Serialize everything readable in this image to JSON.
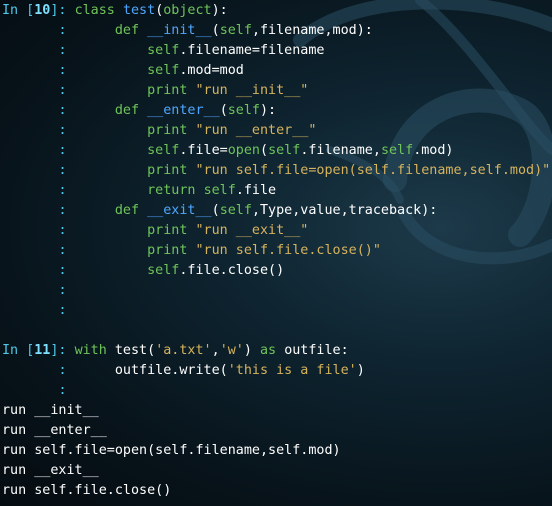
{
  "cells": [
    {
      "in_label": "In [",
      "number": "10",
      "in_close": "]:",
      "lines": [
        [
          {
            "t": "class ",
            "c": "kw"
          },
          {
            "t": "test",
            "c": "fn"
          },
          {
            "t": "(",
            "c": "var"
          },
          {
            "t": "object",
            "c": "bi"
          },
          {
            "t": "):",
            "c": "var"
          }
        ],
        [
          {
            "t": "    "
          },
          {
            "t": "def ",
            "c": "kw"
          },
          {
            "t": "__init__",
            "c": "fn"
          },
          {
            "t": "(",
            "c": "var"
          },
          {
            "t": "self",
            "c": "slf"
          },
          {
            "t": ",filename,mod):",
            "c": "var"
          }
        ],
        [
          {
            "t": "        "
          },
          {
            "t": "self",
            "c": "slf"
          },
          {
            "t": ".filename=filename",
            "c": "var"
          }
        ],
        [
          {
            "t": "        "
          },
          {
            "t": "self",
            "c": "slf"
          },
          {
            "t": ".mod=mod",
            "c": "var"
          }
        ],
        [
          {
            "t": "        "
          },
          {
            "t": "print ",
            "c": "kw"
          },
          {
            "t": "\"run __init__\"",
            "c": "str"
          }
        ],
        [
          {
            "t": "    "
          },
          {
            "t": "def ",
            "c": "kw"
          },
          {
            "t": "__enter__",
            "c": "fn"
          },
          {
            "t": "(",
            "c": "var"
          },
          {
            "t": "self",
            "c": "slf"
          },
          {
            "t": "):",
            "c": "var"
          }
        ],
        [
          {
            "t": "        "
          },
          {
            "t": "print ",
            "c": "kw"
          },
          {
            "t": "\"run __enter__\"",
            "c": "str"
          }
        ],
        [
          {
            "t": "        "
          },
          {
            "t": "self",
            "c": "slf"
          },
          {
            "t": ".file=",
            "c": "var"
          },
          {
            "t": "open",
            "c": "bi"
          },
          {
            "t": "(",
            "c": "var"
          },
          {
            "t": "self",
            "c": "slf"
          },
          {
            "t": ".filename,",
            "c": "var"
          },
          {
            "t": "self",
            "c": "slf"
          },
          {
            "t": ".mod)",
            "c": "var"
          }
        ],
        [
          {
            "t": "        "
          },
          {
            "t": "print ",
            "c": "kw"
          },
          {
            "t": "\"run self.file=open(self.filename,self.mod)\"",
            "c": "str"
          }
        ],
        [
          {
            "t": "        "
          },
          {
            "t": "return ",
            "c": "kw"
          },
          {
            "t": "self",
            "c": "slf"
          },
          {
            "t": ".file",
            "c": "var"
          }
        ],
        [
          {
            "t": "    "
          },
          {
            "t": "def ",
            "c": "kw"
          },
          {
            "t": "__exit__",
            "c": "fn"
          },
          {
            "t": "(",
            "c": "var"
          },
          {
            "t": "self",
            "c": "slf"
          },
          {
            "t": ",Type,value,traceback):",
            "c": "var"
          }
        ],
        [
          {
            "t": "        "
          },
          {
            "t": "print ",
            "c": "kw"
          },
          {
            "t": "\"run __exit__\"",
            "c": "str"
          }
        ],
        [
          {
            "t": "        "
          },
          {
            "t": "print ",
            "c": "kw"
          },
          {
            "t": "\"run self.file.close()\"",
            "c": "str"
          }
        ],
        [
          {
            "t": "        "
          },
          {
            "t": "self",
            "c": "slf"
          },
          {
            "t": ".file.close()",
            "c": "var"
          }
        ],
        [],
        []
      ]
    },
    {
      "in_label": "In [",
      "number": "11",
      "in_close": "]:",
      "lines": [
        [
          {
            "t": "with ",
            "c": "kw"
          },
          {
            "t": "test(",
            "c": "var"
          },
          {
            "t": "'a.txt'",
            "c": "str"
          },
          {
            "t": ",",
            "c": "var"
          },
          {
            "t": "'w'",
            "c": "str"
          },
          {
            "t": ") ",
            "c": "var"
          },
          {
            "t": "as ",
            "c": "kw"
          },
          {
            "t": "outfile:",
            "c": "var"
          }
        ],
        [
          {
            "t": "    "
          },
          {
            "t": "outfile.write(",
            "c": "var"
          },
          {
            "t": "'this is a file'",
            "c": "str"
          },
          {
            "t": ")",
            "c": "var"
          }
        ],
        []
      ]
    }
  ],
  "continuation_marker": ":",
  "output": [
    "run __init__",
    "run __enter__",
    "run self.file=open(self.filename,self.mod)",
    "run __exit__",
    "run self.file.close()"
  ],
  "colors": {
    "prompt": "#4ec9e9",
    "keyword": "#6fc45a",
    "function_name": "#4fa6ff",
    "string": "#d6b35d",
    "text": "#ffffff",
    "background": "#0b1a22"
  },
  "background_decoration": "kali-dragon-logo"
}
